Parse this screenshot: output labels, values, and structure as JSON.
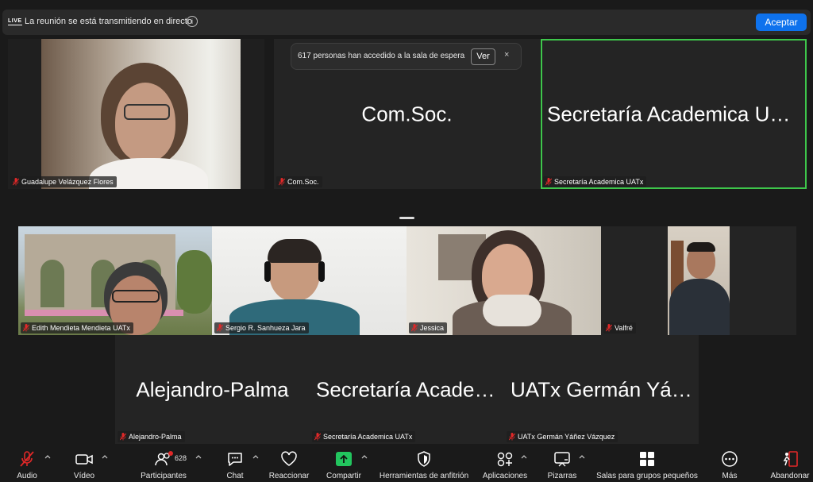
{
  "banner": {
    "live_badge": "LIVE",
    "message": "La reunión se está transmitiendo en directo",
    "info_icon": "i",
    "accept_label": "Aceptar"
  },
  "waiting_room": {
    "message": "617 personas han accedido a la sala de espera",
    "view_label": "Ver",
    "close_glyph": "×"
  },
  "top_row": [
    {
      "name": "Guadalupe Velázquez Flores",
      "video": true
    },
    {
      "name": "Com.Soc.",
      "big_label": "Com.Soc.",
      "video": false
    },
    {
      "name": "Secretaría Academica UATx",
      "big_label": "Secretaría Academica UATx",
      "video": false,
      "active_speaker": true
    }
  ],
  "middle_row": [
    {
      "name": "Edith Mendieta Mendieta UATx",
      "video": true
    },
    {
      "name": "Sergio R. Sanhueza Jara",
      "video": true
    },
    {
      "name": "Jessica",
      "video": true
    },
    {
      "name": "Valfré",
      "video": true
    }
  ],
  "bottom_row": [
    {
      "name": "Alejandro-Palma",
      "big_label": "Alejandro-Palma",
      "video": false
    },
    {
      "name": "Secretaría Academica UATx",
      "big_label": "Secretaría Academica UATx",
      "video": false
    },
    {
      "name": "UATx Germán Yáñez Vázquez",
      "big_label": "UATx Germán Yáñez Vázquez",
      "video": false
    }
  ],
  "toolbar": {
    "audio": "Audio",
    "video": "Vídeo",
    "participants": "Participantes",
    "participants_count": "628",
    "chat": "Chat",
    "react": "Reaccionar",
    "share": "Compartir",
    "host_tools": "Herramientas de anfitrión",
    "apps": "Aplicaciones",
    "whiteboards": "Pizarras",
    "breakout": "Salas para grupos pequeños",
    "more": "Más",
    "leave": "Abandonar"
  },
  "colors": {
    "accent_blue": "#0e72ed",
    "active_speaker_green": "#3ec64b",
    "muted_red": "#e02828",
    "share_green": "#22c55e"
  }
}
